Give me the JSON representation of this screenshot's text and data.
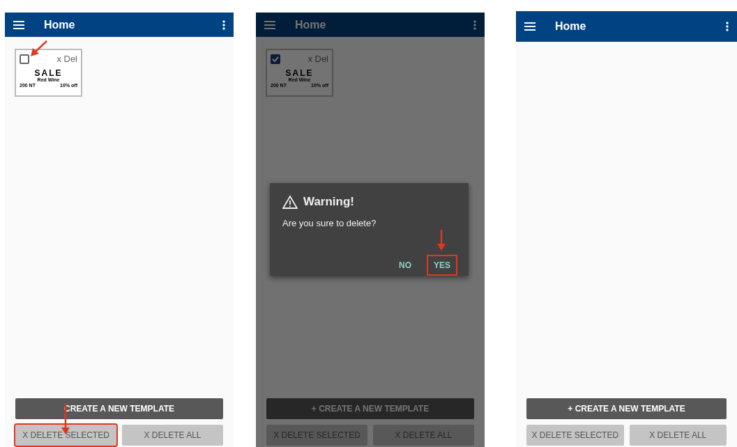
{
  "screens": [
    {
      "title": "Home",
      "dimmed": false,
      "templates": [
        {
          "checked": false,
          "arrow": true,
          "delete_label": "x Del",
          "sale": "SALE",
          "product": "Red Wine",
          "price": "200 NT",
          "discount": "10% off"
        }
      ],
      "create_button": {
        "label": "CREATE A NEW TEMPLATE"
      },
      "delete_buttons": [
        {
          "label": "X DELETE SELECTED",
          "boxed": true,
          "arrow": true
        },
        {
          "label": "X DELETE ALL",
          "boxed": false,
          "arrow": false
        }
      ]
    },
    {
      "title": "Home",
      "dimmed": true,
      "templates": [
        {
          "checked": true,
          "arrow": false,
          "delete_label": "x Del",
          "sale": "SALE",
          "product": "Red Wine",
          "price": "200 NT",
          "discount": "10% off"
        }
      ],
      "dialog": {
        "title": "Warning!",
        "message": "Are you sure to delete?",
        "buttons": [
          {
            "label": "NO",
            "boxed": false,
            "arrow": false
          },
          {
            "label": "YES",
            "boxed": true,
            "arrow": true
          }
        ]
      },
      "create_button": {
        "label": "+ CREATE A NEW TEMPLATE"
      },
      "delete_buttons": [
        {
          "label": "X DELETE SELECTED",
          "boxed": false,
          "arrow": false
        },
        {
          "label": "X DELETE ALL",
          "boxed": false,
          "arrow": false
        }
      ]
    },
    {
      "title": "Home",
      "dimmed": false,
      "create_button": {
        "label": "+ CREATE A NEW TEMPLATE"
      },
      "delete_buttons": [
        {
          "label": "X DELETE SELECTED",
          "boxed": false,
          "arrow": false
        },
        {
          "label": "X DELETE ALL",
          "boxed": false,
          "arrow": false
        }
      ]
    }
  ]
}
